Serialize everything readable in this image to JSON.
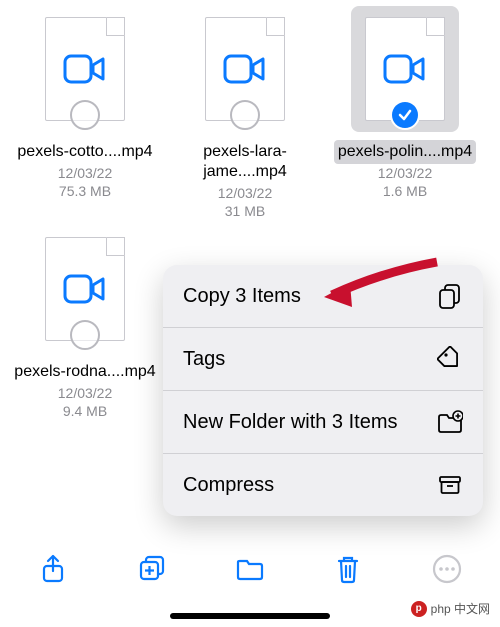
{
  "files": [
    {
      "name": "pexels-cotto....mp4",
      "date": "12/03/22",
      "size": "75.3 MB",
      "selected": false
    },
    {
      "name": "pexels-lara-jame....mp4",
      "date": "12/03/22",
      "size": "31 MB",
      "selected": false
    },
    {
      "name": "pexels-polin....mp4",
      "date": "12/03/22",
      "size": "1.6 MB",
      "selected": true
    },
    {
      "name": "pexels-rodna....mp4",
      "date": "12/03/22",
      "size": "9.4 MB",
      "selected": false
    }
  ],
  "menu": {
    "copy": "Copy 3 Items",
    "tags": "Tags",
    "newfolder": "New Folder with 3 Items",
    "compress": "Compress"
  },
  "watermark": "php 中文网",
  "colors": {
    "accent": "#0a7aff",
    "arrow": "#c8102e"
  }
}
